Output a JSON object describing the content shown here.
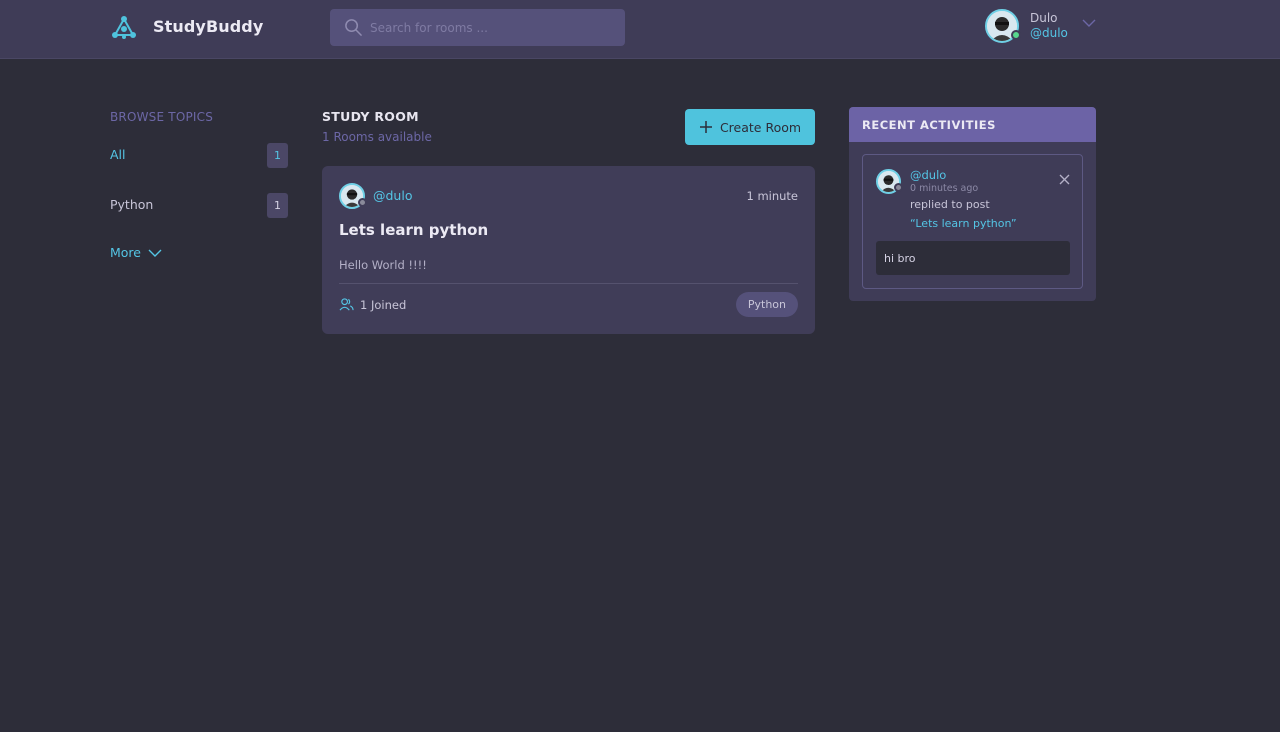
{
  "header": {
    "brand": "StudyBuddy",
    "search_placeholder": "Search for rooms ...",
    "user": {
      "name": "Dulo",
      "handle": "@dulo",
      "status": "online"
    }
  },
  "sidebar": {
    "title": "BROWSE TOPICS",
    "topics": [
      {
        "label": "All",
        "count": "1",
        "active": true
      },
      {
        "label": "Python",
        "count": "1",
        "active": false
      }
    ],
    "more_label": "More"
  },
  "main": {
    "title": "STUDY ROOM",
    "subtitle": "1 Rooms available",
    "create_button": "Create Room",
    "rooms": [
      {
        "host": "@dulo",
        "time": "1 minute",
        "title": "Lets learn python",
        "description": "Hello World !!!!",
        "joined": "1 Joined",
        "topic": "Python"
      }
    ]
  },
  "activities": {
    "title": "RECENT ACTIVITIES",
    "items": [
      {
        "user": "@dulo",
        "time": "0 minutes ago",
        "action": "replied to post",
        "post": "“Lets learn python”",
        "reply": "hi bro"
      }
    ]
  },
  "colors": {
    "background": "#2d2d39",
    "header": "#3f3c57",
    "accent": "#54c5e5",
    "button": "#4fc3dd",
    "activity_header": "#6c63a6",
    "muted_purple": "#6c67a6",
    "online": "#58d68d"
  }
}
